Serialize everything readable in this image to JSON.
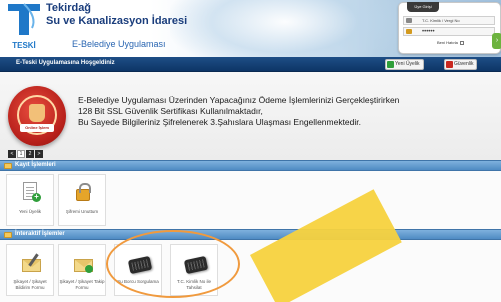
{
  "header": {
    "brand_line1": "Tekirdağ",
    "brand_line2": "Su ve Kanalizasyon İdaresi",
    "app_name": "E-Belediye Uygulaması",
    "logo_text": "TESKİ"
  },
  "login": {
    "tab_label": "Üye Girişi",
    "tc_placeholder": "T.C. Kimlik / Vergi No",
    "password_mask": "••••••",
    "remember_label": "Beni Hatırla",
    "go_icon": "arrow-right-icon"
  },
  "welcome_bar": {
    "text": "E-Teski Uygulamasına Hoşgeldiniz",
    "new_user_label": "Yeni Üyelik",
    "security_label": "Güvenlik"
  },
  "info": {
    "line1": "E-Belediye Uygulaması Üzerinden Yapacağınız Ödeme İşlemlerinizi Gerçekleştirirken",
    "line2": "128 Bit SSL Güvenlik Sertifikası Kullanılmaktadır,",
    "line3": "Bu Sayede Bilgileriniz Şifrelenerek 3.Şahıslara Ulaşması Engellenmektedir.",
    "badge_label": "Online İşlem",
    "pager": [
      "<",
      "1",
      "2",
      ">"
    ]
  },
  "sections": {
    "kayit_title": "Kayıt İşlemleri",
    "interaktif_title": "İnteraktif İşlemler"
  },
  "kayit_items": [
    {
      "label": "Yeni Üyelik",
      "icon": "new-document-icon"
    },
    {
      "label": "Şifremi Unuttum",
      "icon": "lock-icon"
    }
  ],
  "interaktif_items": [
    {
      "label": "Şikayet / Şikayet Bildirim Formu",
      "icon": "envelope-pen-icon"
    },
    {
      "label": "Şikayet / Şikayet Takip Formu",
      "icon": "envelope-arrow-icon"
    },
    {
      "label": "Su Borcu Sorgulama",
      "icon": "card-device-icon"
    },
    {
      "label": "T.C. Kimlik No ile Tahsilat",
      "icon": "card-device-icon"
    }
  ],
  "colors": {
    "brand_navy": "#1a3d7c",
    "section_blue": "#4f8bc3",
    "highlight_orange": "#f09a3e",
    "arrow_yellow": "#f7d23e"
  }
}
